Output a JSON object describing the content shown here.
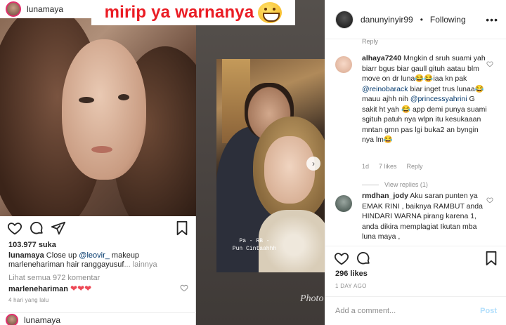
{
  "banner": {
    "text": "mirip ya warnanya"
  },
  "inner_post": {
    "username": "lunamaya",
    "likes": "103.977 suka",
    "caption": {
      "username": "lunamaya",
      "text_before": " Close up ",
      "mention": "@leovir_",
      "text_after": " makeup marlenehariman hair ranggayusuf",
      "more": "... lainnya"
    },
    "view_all_comments": "Lihat semua 972 komentar",
    "comment": {
      "username": "marlenehariman",
      "text": "❤❤❤"
    },
    "time": "4 hari yang lalu",
    "next_username": "lunamaya"
  },
  "story": {
    "caption_line1": "Pa - RB -",
    "caption_line2": "Pun Cintaahhh",
    "watermark": "Photo",
    "nav_arrow": "›"
  },
  "sidebar": {
    "header": {
      "username": "danunyinyir99",
      "separator": "•",
      "follow_status": "Following",
      "more": "•••"
    },
    "reply_top": "Reply",
    "comments": [
      {
        "username": "alhaya7240",
        "text_1": " Mngkin d sruh suami yah biarr bgus biar gaull gituh aatau blm move on dr luna😂😂iaa kn pak ",
        "mention_1": "@reinobarack",
        "text_2": " biar inget trus lunaa😂mauu ajhh nih ",
        "mention_2": "@princessyahrini",
        "text_3": " G sakit ht yah 😂 app demi punya suami sgituh patuh nya wlpn itu kesukaaan mntan gmn pas lgi buka2 an byngin nya lm😂",
        "age": "1d",
        "likes": "7 likes",
        "reply": "Reply",
        "view_replies": "View replies (1)"
      },
      {
        "username": "rmdhan_jody",
        "text": " Aku saran punten ya EMAK RINI , baiknya RAMBUT anda HINDARI WARNA pirang karena 1, anda dikira memplagiat Ikutan mba luna maya ,"
      }
    ],
    "likes": "296 likes",
    "time": "1 DAY AGO",
    "add_comment_placeholder": "Add a comment...",
    "post_label": "Post"
  }
}
